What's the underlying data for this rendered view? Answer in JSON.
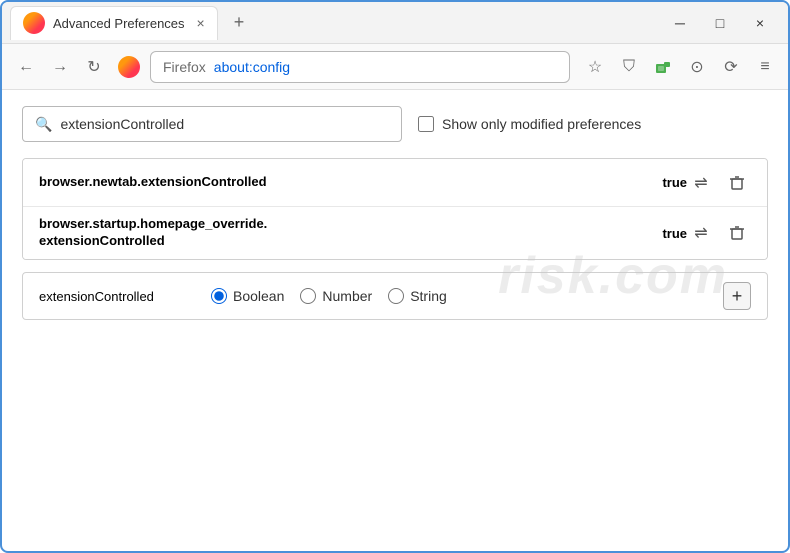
{
  "window": {
    "title": "Advanced Preferences",
    "close_icon": "×",
    "minimize_icon": "─",
    "maximize_icon": "□"
  },
  "tab": {
    "label": "Advanced Preferences",
    "close": "×",
    "new_tab": "+"
  },
  "navbar": {
    "back_icon": "←",
    "forward_icon": "→",
    "reload_icon": "↻",
    "address_label": "Firefox",
    "address_url": "about:config",
    "bookmark_icon": "☆",
    "shield_icon": "⛉",
    "extension_icon": "⬛",
    "download_icon": "⊙",
    "history_icon": "⟳",
    "menu_icon": "≡"
  },
  "search": {
    "placeholder": "extensionControlled",
    "value": "extensionControlled",
    "show_modified_label": "Show only modified preferences"
  },
  "preferences": [
    {
      "name": "browser.newtab.extensionControlled",
      "value": "true",
      "multiline": false
    },
    {
      "name": "browser.startup.homepage_override.\nextensionControlled",
      "name_line1": "browser.startup.homepage_override.",
      "name_line2": "extensionControlled",
      "value": "true",
      "multiline": true
    }
  ],
  "new_pref": {
    "name": "extensionControlled",
    "type_options": [
      {
        "id": "boolean",
        "label": "Boolean",
        "selected": true
      },
      {
        "id": "number",
        "label": "Number",
        "selected": false
      },
      {
        "id": "string",
        "label": "String",
        "selected": false
      }
    ],
    "add_label": "+"
  },
  "icons": {
    "toggle": "⇌",
    "delete": "🗑",
    "search": "🔍"
  },
  "watermark": {
    "text": "risk.com"
  }
}
